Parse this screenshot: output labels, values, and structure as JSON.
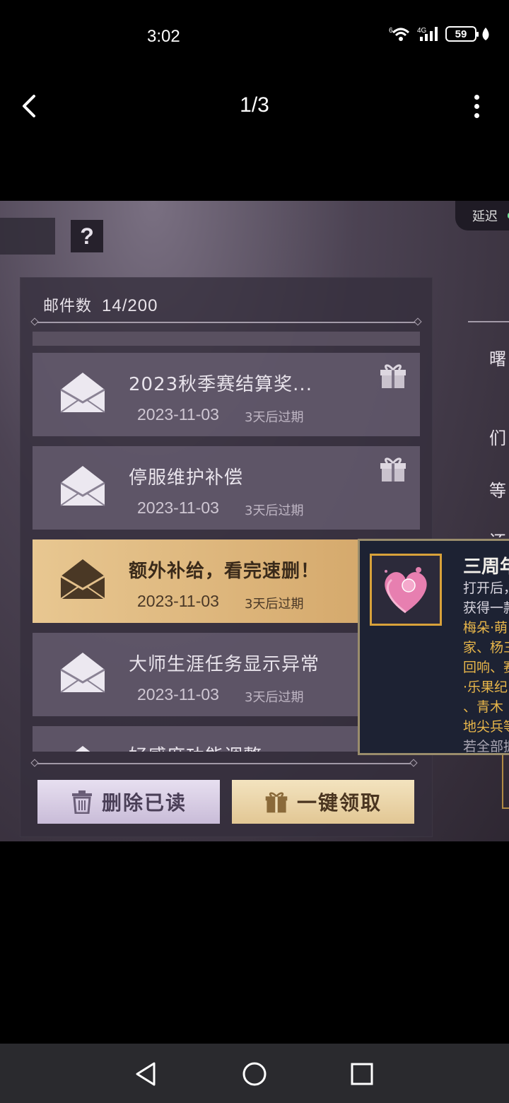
{
  "status": {
    "time": "3:02",
    "network": "4G",
    "battery": "59",
    "wifi_label": "6"
  },
  "viewer": {
    "counter": "1/3"
  },
  "game": {
    "help_label": "?",
    "delay_label": "延迟",
    "mail_count_label": "邮件数",
    "mail_count_value": "14/200",
    "mails": [
      {
        "title": "2023秋季赛结算奖...",
        "date": "2023-11-03",
        "expire": "3天后过期",
        "has_gift": true,
        "selected": false
      },
      {
        "title": "停服维护补偿",
        "date": "2023-11-03",
        "expire": "3天后过期",
        "has_gift": true,
        "selected": false
      },
      {
        "title": "额外补给，看完速删！",
        "date": "2023-11-03",
        "expire": "3天后过期",
        "has_gift": false,
        "selected": true
      },
      {
        "title": "大师生涯任务显示异常",
        "date": "2023-11-03",
        "expire": "3天后过期",
        "has_gift": false,
        "selected": false
      },
      {
        "title": "好感度功能调整",
        "date": "",
        "expire": "",
        "has_gift": false,
        "selected": false
      }
    ],
    "buttons": {
      "delete_read": "删除已读",
      "claim_all": "一键领取"
    },
    "right_fragments": [
      "曙",
      "们",
      "等",
      "还"
    ],
    "popup": {
      "title": "三周年",
      "line1": "打开后，",
      "line2": "获得一款",
      "line3": "梅朵·萌",
      "line4": "家、杨三",
      "line5": "回响、赛",
      "line6": "·乐果纪",
      "line7": "、青木",
      "line8": "地尖兵等",
      "line9": "若全部拥"
    }
  },
  "navbar": {
    "back": "back",
    "home": "home",
    "recents": "recents"
  }
}
